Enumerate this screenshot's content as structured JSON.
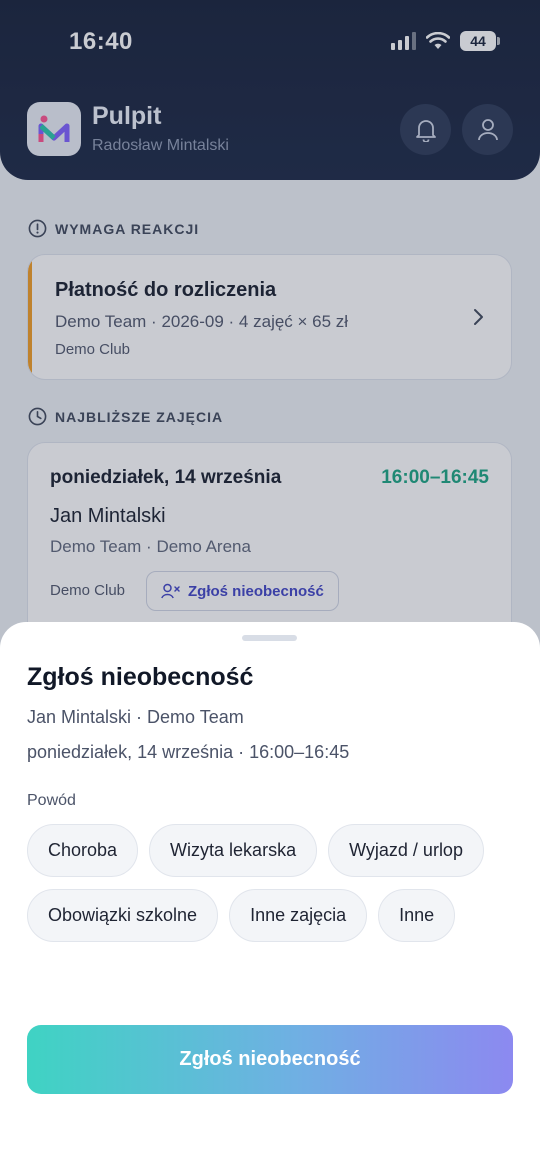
{
  "status_bar": {
    "time": "16:40",
    "battery": "44"
  },
  "header": {
    "title": "Pulpit",
    "subtitle": "Radosław Mintalski",
    "logo_icon": "app-logo-m",
    "bell_icon": "bell-icon",
    "user_icon": "user-icon"
  },
  "sections": {
    "action_required": "WYMAGA REAKCJI",
    "upcoming": "NAJBLIŻSZE ZAJĘCIA"
  },
  "payment_card": {
    "title": "Płatność do rozliczenia",
    "meta": "Demo Team · 2026-09 · 4 zajęć × 65 zł",
    "club": "Demo Club",
    "accent_color": "#f29a1c"
  },
  "session_card": {
    "date": "poniedziałek, 14 września",
    "time": "16:00–16:45",
    "name": "Jan Mintalski",
    "meta": "Demo Team · Demo Arena",
    "club": "Demo Club",
    "absence_button": "Zgłoś nieobecność",
    "time_color": "#14a37f"
  },
  "sheet": {
    "title": "Zgłoś nieobecność",
    "line1": "Jan Mintalski · Demo Team",
    "line2": "poniedziałek, 14 września · 16:00–16:45",
    "reason_label": "Powód",
    "reasons": [
      "Choroba",
      "Wizyta lekarska",
      "Wyjazd / urlop",
      "Obowiązki szkolne",
      "Inne zajęcia",
      "Inne"
    ],
    "submit": "Zgłoś nieobecność"
  }
}
